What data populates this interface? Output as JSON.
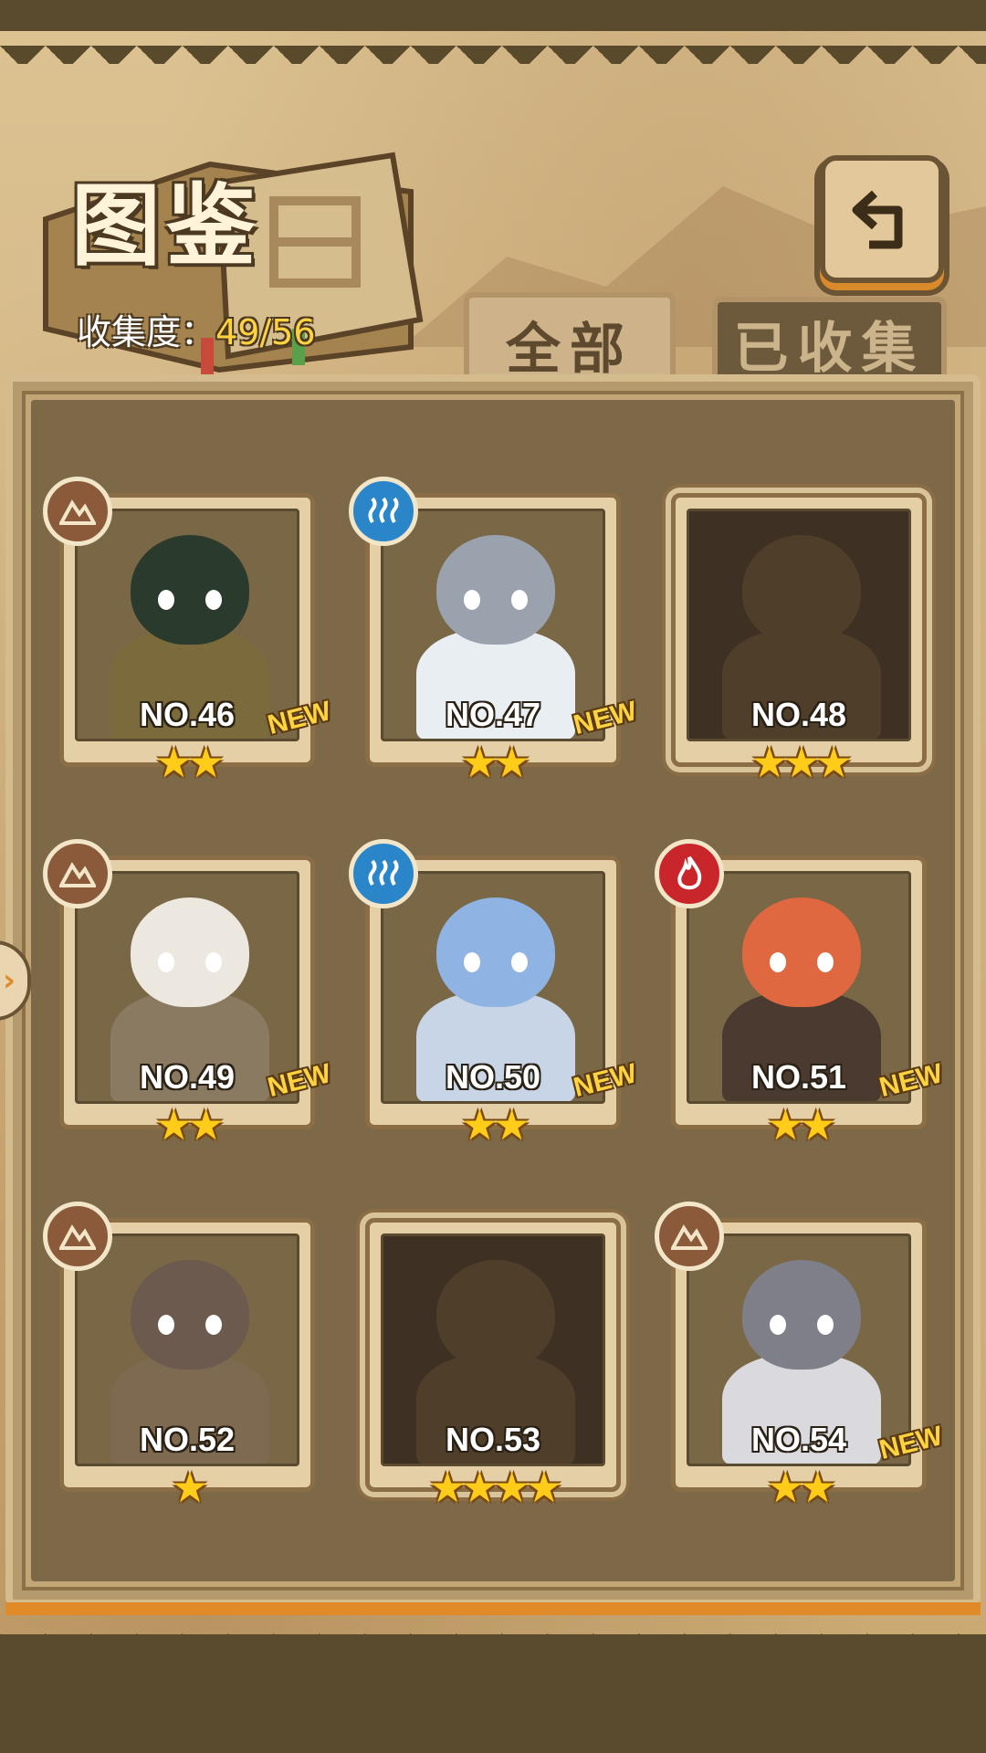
{
  "header": {
    "title": "图鉴",
    "collection_label": "收集度：",
    "collection_value": "49/56"
  },
  "tabs": [
    {
      "label": "全部",
      "active": true
    },
    {
      "label": "已收集",
      "active": false
    }
  ],
  "back_button": {
    "icon": "return-arrow-icon"
  },
  "colors": {
    "accent": "#e08a2a",
    "star": "#ffcc1a",
    "new": "#ffd340"
  },
  "cards": [
    {
      "number": "NO.46",
      "stars": "★★",
      "new": "NEW",
      "element": "earth",
      "locked": false
    },
    {
      "number": "NO.47",
      "stars": "★★",
      "new": "NEW",
      "element": "water",
      "locked": false
    },
    {
      "number": "NO.48",
      "stars": "★★★",
      "new": "",
      "element": "",
      "locked": true
    },
    {
      "number": "NO.49",
      "stars": "★★",
      "new": "NEW",
      "element": "earth",
      "locked": false
    },
    {
      "number": "NO.50",
      "stars": "★★",
      "new": "NEW",
      "element": "water",
      "locked": false
    },
    {
      "number": "NO.51",
      "stars": "★★",
      "new": "NEW",
      "element": "fire",
      "locked": false
    },
    {
      "number": "NO.52",
      "stars": "★",
      "new": "",
      "element": "earth",
      "locked": false
    },
    {
      "number": "NO.53",
      "stars": "★★★★",
      "new": "",
      "element": "",
      "locked": true
    },
    {
      "number": "NO.54",
      "stars": "★★",
      "new": "NEW",
      "element": "earth",
      "locked": false
    }
  ]
}
